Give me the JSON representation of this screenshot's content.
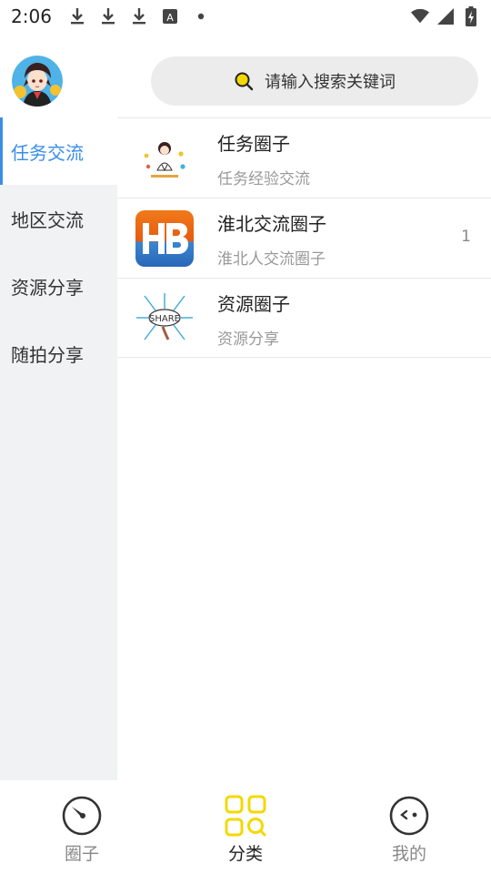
{
  "status_bar": {
    "time": "2:06",
    "left_icons": [
      "download-icon",
      "download-icon",
      "download-icon",
      "a-box-icon",
      "dot-icon"
    ],
    "right_icons": [
      "wifi-icon",
      "signal-icon",
      "battery-charging-icon"
    ]
  },
  "header": {
    "search_placeholder": "请输入搜索关键词"
  },
  "sidebar": {
    "items": [
      {
        "label": "任务交流",
        "active": true
      },
      {
        "label": "地区交流",
        "active": false
      },
      {
        "label": "资源分享",
        "active": false
      },
      {
        "label": "随拍分享",
        "active": false
      }
    ]
  },
  "list": {
    "items": [
      {
        "title": "任务圈子",
        "subtitle": "任务经验交流",
        "count": ""
      },
      {
        "title": "淮北交流圈子",
        "subtitle": "淮北人交流圈子",
        "count": "1"
      },
      {
        "title": "资源圈子",
        "subtitle": "资源分享",
        "count": ""
      }
    ]
  },
  "bottom_nav": {
    "items": [
      {
        "label": "圈子",
        "icon": "compass-icon",
        "active": false
      },
      {
        "label": "分类",
        "icon": "category-icon",
        "active": true
      },
      {
        "label": "我的",
        "icon": "face-icon",
        "active": false
      }
    ]
  },
  "colors": {
    "accent_blue": "#3a8ee6",
    "accent_yellow": "#f5d800",
    "sidebar_bg": "#f1f2f4",
    "search_bg": "#ececec"
  }
}
